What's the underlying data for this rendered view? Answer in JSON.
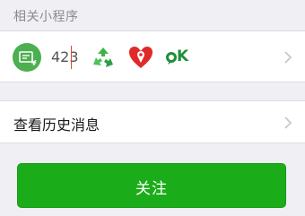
{
  "mini_programs": {
    "header": "相关小程序",
    "apps": [
      {
        "icon": "invoice-app-icon",
        "color": "#4caf50"
      },
      {
        "icon": "423-app-icon",
        "text": "423"
      },
      {
        "icon": "recycle-app-icon",
        "color": "#3cb44b"
      },
      {
        "icon": "heart-location-app-icon",
        "color": "#e02a2a"
      },
      {
        "icon": "ok-app-icon",
        "text": "K",
        "color": "#1f8f3a"
      }
    ]
  },
  "history": {
    "label": "查看历史消息"
  },
  "follow": {
    "label": "关注",
    "color": "#1aad19"
  }
}
